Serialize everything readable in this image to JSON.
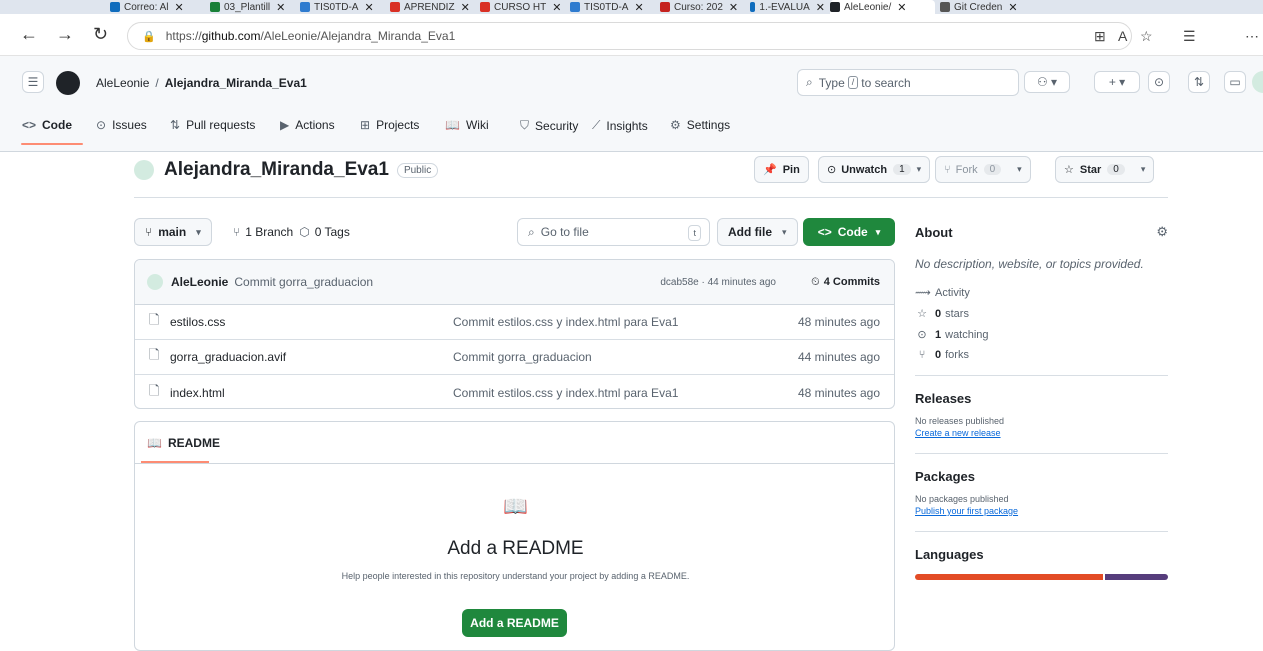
{
  "browser": {
    "tabs": [
      {
        "label": "Correo: Al",
        "color": "#0f6cbd"
      },
      {
        "label": "03_Plantill",
        "color": "#188038"
      },
      {
        "label": "TIS0TD-A",
        "color": "#2e7bcf"
      },
      {
        "label": "APRENDIZ",
        "color": "#d93025"
      },
      {
        "label": "CURSO HT",
        "color": "#d93025"
      },
      {
        "label": "TIS0TD-A",
        "color": "#2e7bcf"
      },
      {
        "label": "Curso: 202",
        "color": "#c5221f"
      },
      {
        "label": "1.-EVALUA",
        "color": "#0f6cbd"
      },
      {
        "label": "AleLeonie/",
        "color": "#1f2328"
      },
      {
        "label": "Git Creden",
        "color": "#555"
      }
    ],
    "url_prefix": "https://",
    "url_host": "github.com",
    "url_path": "/AleLeonie/Alejandra_Miranda_Eva1"
  },
  "header": {
    "owner": "AleLeonie",
    "separator": "/",
    "repo": "Alejandra_Miranda_Eva1",
    "search_pre": "Type",
    "search_key": "/",
    "search_post": "to search"
  },
  "repo_nav": {
    "tabs": [
      {
        "label": "Code",
        "icon": "<>"
      },
      {
        "label": "Issues",
        "icon": "⊙"
      },
      {
        "label": "Pull requests",
        "icon": "⇅"
      },
      {
        "label": "Actions",
        "icon": "▶"
      },
      {
        "label": "Projects",
        "icon": "⊞"
      },
      {
        "label": "Wiki",
        "icon": "📖"
      },
      {
        "label": "Security",
        "icon": "⛉"
      },
      {
        "label": "Insights",
        "icon": "⟋"
      },
      {
        "label": "Settings",
        "icon": "⚙"
      }
    ]
  },
  "repo": {
    "name": "Alejandra_Miranda_Eva1",
    "visibility": "Public",
    "pin": "Pin",
    "unwatch": "Unwatch",
    "watch_count": "1",
    "fork": "Fork",
    "fork_count": "0",
    "star": "Star",
    "star_count": "0"
  },
  "toolbar": {
    "branch": "main",
    "branches": "1 Branch",
    "tags": "0 Tags",
    "goto_placeholder": "Go to file",
    "goto_key": "t",
    "add_file": "Add file",
    "code": "Code"
  },
  "commit": {
    "author": "AleLeonie",
    "message": "Commit gorra_graduacion",
    "meta": "dcab58e · 44 minutes ago",
    "commits": "4 Commits"
  },
  "files": [
    {
      "name": "estilos.css",
      "message": "Commit estilos.css y index.html para Eva1",
      "time": "48 minutes ago"
    },
    {
      "name": "gorra_graduacion.avif",
      "message": "Commit gorra_graduacion",
      "time": "44 minutes ago"
    },
    {
      "name": "index.html",
      "message": "Commit estilos.css y index.html para Eva1",
      "time": "48 minutes ago"
    }
  ],
  "readme": {
    "tab": "README",
    "title": "Add a README",
    "subtitle": "Help people interested in this repository understand your project by adding a README.",
    "button": "Add a README"
  },
  "about": {
    "title": "About",
    "description": "No description, website, or topics provided.",
    "activity": "Activity",
    "stars_n": "0",
    "stars": "stars",
    "watching_n": "1",
    "watching": "watching",
    "forks_n": "0",
    "forks": "forks"
  },
  "releases": {
    "title": "Releases",
    "none": "No releases published",
    "link": "Create a new release"
  },
  "packages": {
    "title": "Packages",
    "none": "No packages published",
    "link": "Publish your first package"
  },
  "languages": {
    "title": "Languages",
    "colors": [
      "#e34c26",
      "#563d7c"
    ],
    "shares": [
      0.75,
      0.25
    ]
  }
}
